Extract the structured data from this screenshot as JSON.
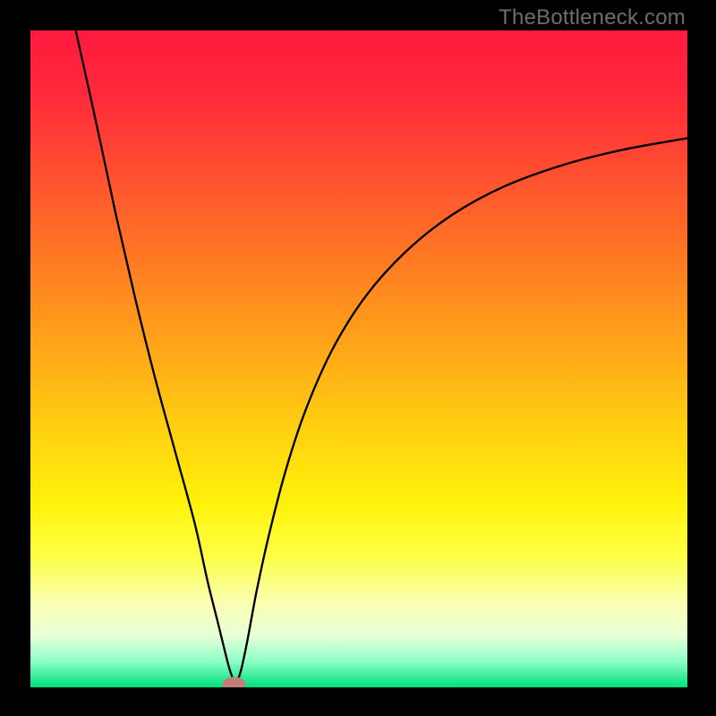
{
  "watermark": "TheBottleneck.com",
  "chart_data": {
    "type": "line",
    "title": "",
    "xlabel": "",
    "ylabel": "",
    "xlim": [
      0,
      100
    ],
    "ylim": [
      0,
      100
    ],
    "gradient_stops": [
      {
        "offset": 0.0,
        "color": "#ff1a3e"
      },
      {
        "offset": 0.1,
        "color": "#ff2a3a"
      },
      {
        "offset": 0.22,
        "color": "#ff5030"
      },
      {
        "offset": 0.35,
        "color": "#ff7a23"
      },
      {
        "offset": 0.48,
        "color": "#ffa518"
      },
      {
        "offset": 0.6,
        "color": "#ffce10"
      },
      {
        "offset": 0.72,
        "color": "#fff20a"
      },
      {
        "offset": 0.8,
        "color": "#fdff45"
      },
      {
        "offset": 0.87,
        "color": "#faffb0"
      },
      {
        "offset": 0.92,
        "color": "#e9ffd8"
      },
      {
        "offset": 0.96,
        "color": "#8effc7"
      },
      {
        "offset": 1.0,
        "color": "#00e07a"
      }
    ],
    "marker": {
      "x": 31,
      "y": 0.4,
      "rx": 1.8,
      "ry": 1.2,
      "color": "#c08078"
    },
    "series": [
      {
        "name": "bottleneck-curve",
        "x": [
          6.9,
          10,
          13,
          16,
          19,
          22,
          25,
          27,
          28.5,
          29.6,
          30.4,
          31.2,
          32.0,
          33,
          34.5,
          36.5,
          39,
          42,
          46,
          51,
          57,
          64,
          72,
          81,
          90,
          100
        ],
        "values": [
          100,
          86,
          72,
          59,
          47,
          36,
          25,
          16,
          10,
          5.5,
          2.5,
          0.8,
          2.4,
          7,
          15,
          24,
          33.5,
          42.5,
          51.5,
          59.5,
          66.2,
          71.8,
          76.2,
          79.5,
          81.8,
          83.6
        ]
      }
    ]
  }
}
